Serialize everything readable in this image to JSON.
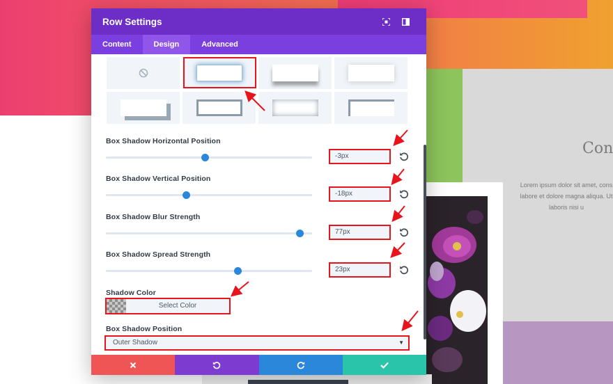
{
  "colors": {
    "header": "#6c2ec7",
    "tabs": "#7b3fe0",
    "active_tab": "#8f56e9",
    "accent": "#2b87da",
    "annotation": "#e8141b",
    "discard": "#ef5555",
    "undo": "#7e3bd0",
    "redo": "#2b87da",
    "save": "#29c4a9"
  },
  "background": {
    "heading": "Con",
    "lorem_lines": [
      "Lorem ipsum dolor sit amet, cons",
      "labore et dolore magna aliqua. Ut",
      "laboris nisi u"
    ]
  },
  "modal": {
    "title": "Row Settings",
    "header_icons": [
      "fullscreen-icon",
      "sidebar-icon"
    ],
    "tabs": [
      {
        "label": "Content",
        "active": false
      },
      {
        "label": "Design",
        "active": true
      },
      {
        "label": "Advanced",
        "active": false
      }
    ],
    "shadow_presets": [
      "none",
      "glow",
      "bottom",
      "soft",
      "offset-corner",
      "border",
      "inner-glow",
      "inner-corner"
    ],
    "selected_preset": 1,
    "settings": [
      {
        "key": "horizontal",
        "label": "Box Shadow Horizontal Position",
        "value": "-3px",
        "slider_fraction": 0.48
      },
      {
        "key": "vertical",
        "label": "Box Shadow Vertical Position",
        "value": "-18px",
        "slider_fraction": 0.39
      },
      {
        "key": "blur",
        "label": "Box Shadow Blur Strength",
        "value": "77px",
        "slider_fraction": 0.94
      },
      {
        "key": "spread",
        "label": "Box Shadow Spread Strength",
        "value": "23px",
        "slider_fraction": 0.64
      }
    ],
    "shadow_color": {
      "label": "Shadow Color",
      "button": "Select Color"
    },
    "shadow_position": {
      "label": "Box Shadow Position",
      "value": "Outer Shadow"
    },
    "footer": [
      {
        "name": "discard",
        "icon": "close-icon"
      },
      {
        "name": "undo",
        "icon": "undo-icon"
      },
      {
        "name": "redo",
        "icon": "redo-icon"
      },
      {
        "name": "save",
        "icon": "check-icon"
      }
    ]
  }
}
